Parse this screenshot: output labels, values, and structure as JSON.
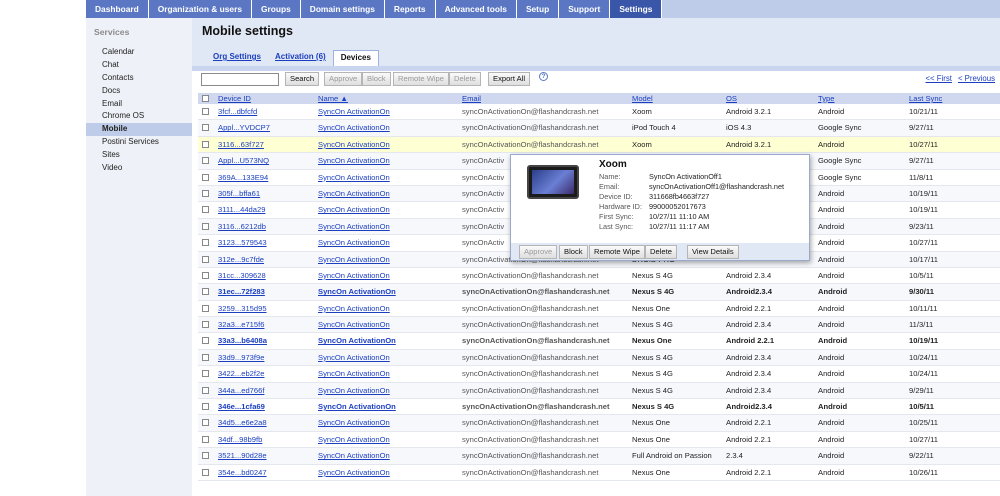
{
  "topnav": [
    "Dashboard",
    "Organization & users",
    "Groups",
    "Domain settings",
    "Reports",
    "Advanced tools",
    "Setup",
    "Support",
    "Settings"
  ],
  "sidebar": {
    "header": "Services",
    "items": [
      "Calendar",
      "Chat",
      "Contacts",
      "Docs",
      "Email",
      "Chrome OS",
      "Mobile",
      "Postini Services",
      "Sites",
      "Video"
    ]
  },
  "page": {
    "title": "Mobile settings",
    "subtabs": [
      "Org Settings",
      "Activation (6)",
      "Devices"
    ]
  },
  "toolbar": {
    "search_value": "",
    "search_button": "Search",
    "approve": "Approve",
    "block": "Block",
    "remote_wipe": "Remote Wipe",
    "delete": "Delete",
    "export_all": "Export All",
    "help": "?",
    "first": "<< First",
    "previous": "< Previous"
  },
  "table": {
    "headers": {
      "device_id": "Device ID",
      "name": "Name ▲",
      "email": "Email",
      "model": "Model",
      "os": "OS",
      "type": "Type",
      "last_sync": "Last Sync"
    },
    "rows": [
      {
        "id": "3fcf...dbfcfd",
        "name": "SyncOn ActivationOn",
        "email": "syncOnActivationOn@flashandcrash.net",
        "model": "Xoom",
        "os": "Android 3.2.1",
        "type": "Android",
        "sync": "10/21/11"
      },
      {
        "id": "Appl...YVDCP7",
        "name": "SyncOn ActivationOn",
        "email": "syncOnActivationOn@flashandcrash.net",
        "model": "iPod Touch 4",
        "os": "iOS 4.3",
        "type": "Google Sync",
        "sync": "9/27/11"
      },
      {
        "id": "3116...63f727",
        "name": "SyncOn ActivationOn",
        "email": "syncOnActivationOn@flashandcrash.net",
        "model": "Xoom",
        "os": "Android 3.2.1",
        "type": "Android",
        "sync": "10/27/11"
      },
      {
        "id": "Appl...U573NQ",
        "name": "SyncOn ActivationOn",
        "email": "syncOnActiv",
        "model": "",
        "os": "",
        "type": "Google Sync",
        "sync": "9/27/11"
      },
      {
        "id": "369A...133E94",
        "name": "SyncOn ActivationOn",
        "email": "syncOnActiv",
        "model": "",
        "os": "",
        "type": "Google Sync",
        "sync": "11/8/11"
      },
      {
        "id": "305f...bffa61",
        "name": "SyncOn ActivationOn",
        "email": "syncOnActiv",
        "model": "",
        "os": "",
        "type": "Android",
        "sync": "10/19/11"
      },
      {
        "id": "3111...44da29",
        "name": "SyncOn ActivationOn",
        "email": "syncOnActiv",
        "model": "",
        "os": "",
        "type": "Android",
        "sync": "10/19/11"
      },
      {
        "id": "3116...6212db",
        "name": "SyncOn ActivationOn",
        "email": "syncOnActiv",
        "model": "",
        "os": "",
        "type": "Android",
        "sync": "9/23/11"
      },
      {
        "id": "3123...579543",
        "name": "SyncOn ActivationOn",
        "email": "syncOnActiv",
        "model": "",
        "os": "",
        "type": "Android",
        "sync": "10/27/11"
      },
      {
        "id": "312e...9c7fde",
        "name": "SyncOn ActivationOn",
        "email": "syncOnActivationOn@flashandcrash.net",
        "model": "DROID PRO",
        "os": "",
        "type": "Android",
        "sync": "10/17/11"
      },
      {
        "id": "31cc...309628",
        "name": "SyncOn ActivationOn",
        "email": "syncOnActivationOn@flashandcrash.net",
        "model": "Nexus S 4G",
        "os": "Android 2.3.4",
        "type": "Android",
        "sync": "10/5/11"
      },
      {
        "id": "31ec...72f283",
        "name": "SyncOn ActivationOn",
        "email": "syncOnActivationOn@flashandcrash.net",
        "model": "Nexus S 4G",
        "os": "Android2.3.4",
        "type": "Android",
        "sync": "9/30/11",
        "bold": true
      },
      {
        "id": "3259...315d95",
        "name": "SyncOn ActivationOn",
        "email": "syncOnActivationOn@flashandcrash.net",
        "model": "Nexus One",
        "os": "Android 2.2.1",
        "type": "Android",
        "sync": "10/11/11"
      },
      {
        "id": "32a3...e715f6",
        "name": "SyncOn ActivationOn",
        "email": "syncOnActivationOn@flashandcrash.net",
        "model": "Nexus S 4G",
        "os": "Android  2.3.4",
        "type": "Android",
        "sync": "11/3/11"
      },
      {
        "id": "33a3...b6408a",
        "name": "SyncOn ActivationOn",
        "email": "syncOnActivationOn@flashandcrash.net",
        "model": "Nexus One",
        "os": "Android 2.2.1",
        "type": "Android",
        "sync": "10/19/11",
        "bold": true
      },
      {
        "id": "33d9...973f9e",
        "name": "SyncOn ActivationOn",
        "email": "syncOnActivationOn@flashandcrash.net",
        "model": "Nexus S 4G",
        "os": "Android  2.3.4",
        "type": "Android",
        "sync": "10/24/11"
      },
      {
        "id": "3422...eb2f2e",
        "name": "SyncOn ActivationOn",
        "email": "syncOnActivationOn@flashandcrash.net",
        "model": "Nexus S 4G",
        "os": "Android  2.3.4",
        "type": "Android",
        "sync": "10/24/11"
      },
      {
        "id": "344a...ed766f",
        "name": "SyncOn ActivationOn",
        "email": "syncOnActivationOn@flashandcrash.net",
        "model": "Nexus S 4G",
        "os": "Android  2.3.4",
        "type": "Android",
        "sync": "9/29/11"
      },
      {
        "id": "346e...1cfa69",
        "name": "SyncOn ActivationOn",
        "email": "syncOnActivationOn@flashandcrash.net",
        "model": "Nexus S 4G",
        "os": "Android2.3.4",
        "type": "Android",
        "sync": "10/5/11",
        "bold": true
      },
      {
        "id": "34d5...e6e2a8",
        "name": "SyncOn ActivationOn",
        "email": "syncOnActivationOn@flashandcrash.net",
        "model": "Nexus One",
        "os": "Android 2.2.1",
        "type": "Android",
        "sync": "10/25/11"
      },
      {
        "id": "34df...98b9fb",
        "name": "SyncOn ActivationOn",
        "email": "syncOnActivationOn@flashandcrash.net",
        "model": "Nexus One",
        "os": "Android 2.2.1",
        "type": "Android",
        "sync": "10/27/11"
      },
      {
        "id": "3521...90d28e",
        "name": "SyncOn ActivationOn",
        "email": "syncOnActivationOn@flashandcrash.net",
        "model": "Full Android on Passion",
        "os": "2.3.4",
        "type": "Android",
        "sync": "9/22/11"
      },
      {
        "id": "354e...bd0247",
        "name": "SyncOn ActivationOn",
        "email": "syncOnActivationOn@flashandcrash.net",
        "model": "Nexus One",
        "os": "Android 2.2.1",
        "type": "Android",
        "sync": "10/26/11"
      }
    ]
  },
  "popup": {
    "title": "Xoom",
    "fields": [
      {
        "k": "Name:",
        "v": "SyncOn ActivationOff1"
      },
      {
        "k": "Email:",
        "v": "syncOnActivationOff1@flashandcrash.net"
      },
      {
        "k": "Device ID:",
        "v": "311668fb4663f727"
      },
      {
        "k": "Hardware ID:",
        "v": "99000052017673"
      },
      {
        "k": "First Sync:",
        "v": "10/27/11 11:10 AM"
      },
      {
        "k": "Last Sync:",
        "v": "10/27/11 11:17 AM"
      }
    ],
    "approve": "Approve",
    "block": "Block",
    "remote_wipe": "Remote Wipe",
    "delete": "Delete",
    "view_details": "View Details"
  }
}
